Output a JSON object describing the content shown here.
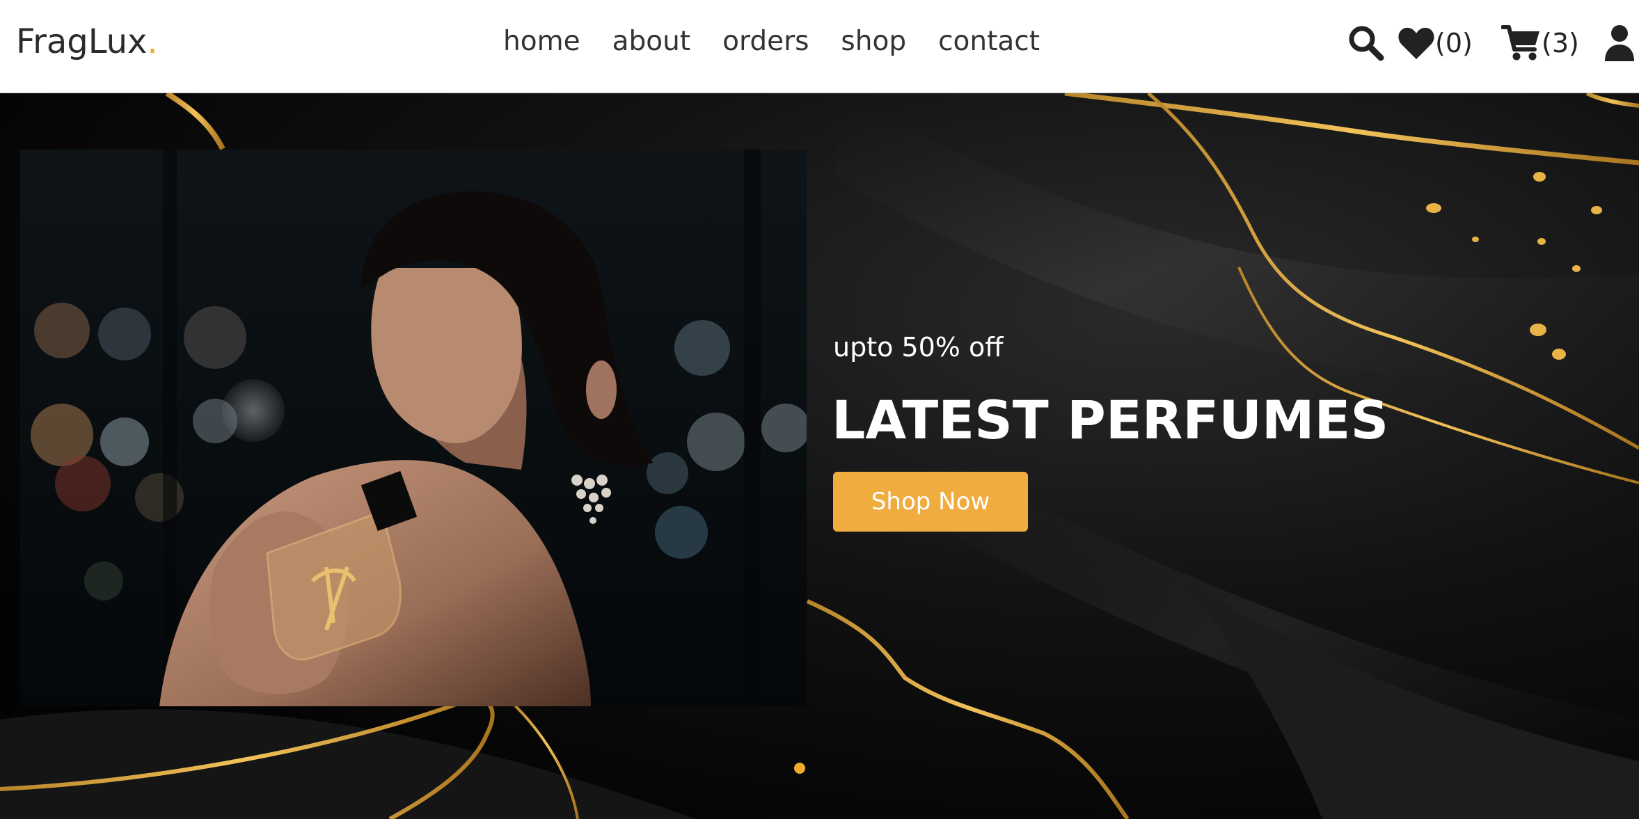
{
  "brand": {
    "name": "FragLux",
    "dot": ".",
    "accent_color": "#f0ac2d"
  },
  "nav": {
    "items": [
      {
        "label": "home"
      },
      {
        "label": "about"
      },
      {
        "label": "orders"
      },
      {
        "label": "shop"
      },
      {
        "label": "contact"
      }
    ]
  },
  "header_icons": {
    "search": {
      "icon": "search-icon"
    },
    "wishlist": {
      "icon": "heart-icon",
      "count": "(0)"
    },
    "cart": {
      "icon": "cart-icon",
      "count": "(3)"
    },
    "account": {
      "icon": "user-icon"
    }
  },
  "hero": {
    "offer_text": "upto 50% off",
    "title": "LATEST PERFUMES",
    "button_label": "Shop Now",
    "button_color": "#f0ac3e",
    "slider_dots": 1,
    "active_dot": 1
  }
}
